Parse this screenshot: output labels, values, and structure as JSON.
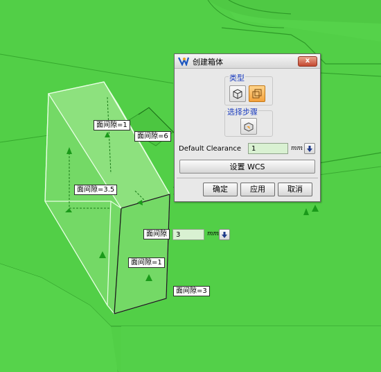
{
  "dialog": {
    "title": "创建箱体",
    "close_label": "x",
    "type_group_label": "类型",
    "step_group_label": "选择步骤",
    "default_clearance_label": "Default Clearance",
    "default_clearance_value": "1",
    "unit": "mm",
    "wcs_button_label": "设置 WCS",
    "ok_label": "确定",
    "apply_label": "应用",
    "cancel_label": "取消"
  },
  "floating_field": {
    "label": "面间隙",
    "value": "3",
    "unit": "mm"
  },
  "tags": {
    "t1": "面间隙=1",
    "t2": "面间隙=6",
    "t3": "面间隙=3.5",
    "t4": "面间隙=1",
    "t5": "面间隙=3"
  },
  "icons": [
    "app-icon",
    "close-icon",
    "box-type-icon",
    "block-type-icon",
    "select-step-icon",
    "dropdown-arrow-icon"
  ],
  "colors": {
    "model_green": "#55d24a",
    "field_green": "#d9f1d2",
    "active_orange": "#f4a13b",
    "group_label_blue": "#1e3fbf"
  }
}
